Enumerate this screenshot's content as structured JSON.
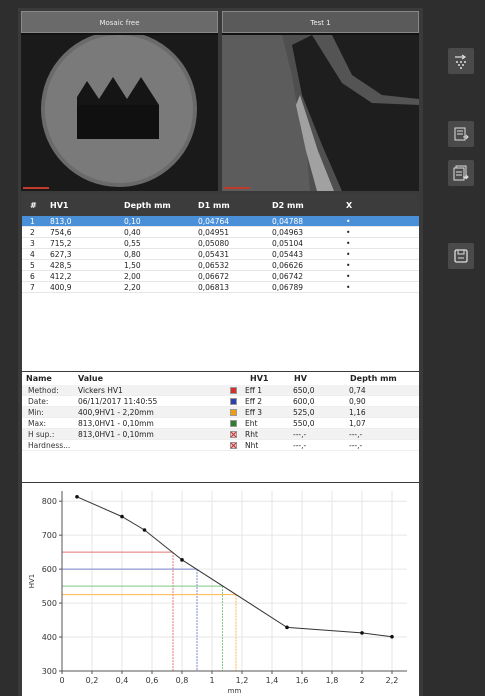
{
  "images": {
    "left_title": "Mosaic free",
    "right_title": "Test 1"
  },
  "measurements": {
    "headers": [
      "#",
      "HV1",
      "Depth mm",
      "D1 mm",
      "D2 mm",
      "X"
    ],
    "rows": [
      {
        "n": "1",
        "hv": "813,0",
        "depth": "0,10",
        "d1": "0,04764",
        "d2": "0,04788",
        "x": "•"
      },
      {
        "n": "2",
        "hv": "754,6",
        "depth": "0,40",
        "d1": "0,04951",
        "d2": "0,04963",
        "x": "•"
      },
      {
        "n": "3",
        "hv": "715,2",
        "depth": "0,55",
        "d1": "0,05080",
        "d2": "0,05104",
        "x": "•"
      },
      {
        "n": "4",
        "hv": "627,3",
        "depth": "0,80",
        "d1": "0,05431",
        "d2": "0,05443",
        "x": "•"
      },
      {
        "n": "5",
        "hv": "428,5",
        "depth": "1,50",
        "d1": "0,06532",
        "d2": "0,06626",
        "x": "•"
      },
      {
        "n": "6",
        "hv": "412,2",
        "depth": "2,00",
        "d1": "0,06672",
        "d2": "0,06742",
        "x": "•"
      },
      {
        "n": "7",
        "hv": "400,9",
        "depth": "2,20",
        "d1": "0,06813",
        "d2": "0,06789",
        "x": "•"
      }
    ]
  },
  "stats": {
    "name_header": "Name",
    "value_header": "Value",
    "hv1_header": "HV1",
    "hv_header": "HV",
    "depth_header": "Depth mm",
    "left": [
      {
        "label": "Method:",
        "value": "Vickers HV1"
      },
      {
        "label": "Date:",
        "value": "06/11/2017 11:40:55"
      },
      {
        "label": "Min:",
        "value": "400,9HV1 - 2,20mm"
      },
      {
        "label": "Max:",
        "value": "813,0HV1 - 0,10mm"
      },
      {
        "label": "H sup.:",
        "value": "813,0HV1 - 0,10mm"
      },
      {
        "label": "Hardness...",
        "value": ""
      }
    ],
    "right": [
      {
        "label": "Eff 1",
        "hv": "650,0",
        "depth": "0,74",
        "color": "#d32f2f",
        "x": false
      },
      {
        "label": "Eff 2",
        "hv": "600,0",
        "depth": "0,90",
        "color": "#2e3fa8",
        "x": false
      },
      {
        "label": "Eff 3",
        "hv": "525,0",
        "depth": "1,16",
        "color": "#f39c12",
        "x": false
      },
      {
        "label": "Eht",
        "hv": "550,0",
        "depth": "1,07",
        "color": "#2e7d32",
        "x": false
      },
      {
        "label": "Rht",
        "hv": "---,-",
        "depth": "---,-",
        "color": "#f4c6c6",
        "x": true
      },
      {
        "label": "Nht",
        "hv": "---,-",
        "depth": "---,-",
        "color": "#f4c6c6",
        "x": true
      }
    ]
  },
  "chart_data": {
    "type": "line",
    "x": [
      0.1,
      0.4,
      0.55,
      0.8,
      1.5,
      2.0,
      2.2
    ],
    "y": [
      813.0,
      754.6,
      715.2,
      627.3,
      428.5,
      412.2,
      400.9
    ],
    "xlabel": "mm",
    "ylabel": "HV1",
    "xlim": [
      0,
      2.3
    ],
    "ylim": [
      300,
      830
    ],
    "xticks": [
      0,
      0.2,
      0.4,
      0.6,
      0.8,
      1,
      1.2,
      1.4,
      1.6,
      1.8,
      2,
      2.2
    ],
    "xtick_labels": [
      "0",
      "0,2",
      "0,4",
      "0,6",
      "0,8",
      "1",
      "1,2",
      "1,4",
      "1,6",
      "1,8",
      "2",
      "2,2"
    ],
    "yticks": [
      300,
      400,
      500,
      600,
      700,
      800
    ],
    "ytick_labels": [
      "300",
      "400",
      "500",
      "600",
      "700",
      "800"
    ],
    "grid": true,
    "reference_lines": [
      {
        "hv": 650,
        "depth": 0.74,
        "color": "#e57373"
      },
      {
        "hv": 600,
        "depth": 0.9,
        "color": "#7986cb"
      },
      {
        "hv": 525,
        "depth": 1.16,
        "color": "#ffb74d"
      },
      {
        "hv": 550,
        "depth": 1.07,
        "color": "#81c784"
      }
    ]
  }
}
